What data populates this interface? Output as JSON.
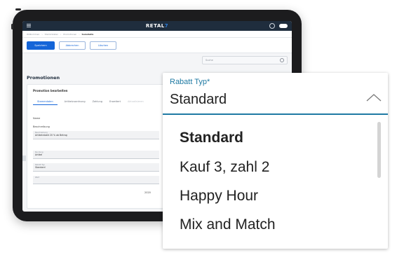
{
  "app": {
    "logo": "RETAL",
    "logo_suffix": "7"
  },
  "breadcrumb": [
    "Willkommen",
    "Stammdaten",
    "Promotionen",
    "Samstatis"
  ],
  "toolbar": {
    "save_label": "Speichern",
    "cancel_label": "Abbrechen",
    "delete_label": "Löschen",
    "search_placeholder": "Suche"
  },
  "page": {
    "title": "Promotionen",
    "actions": [
      "Importieren",
      "Download",
      "Aktualisieren"
    ]
  },
  "card": {
    "title": "Promotion bearbeiten",
    "tabs": [
      "Stammdaten",
      "Artikelzuordnung",
      "Zahlung",
      "Erweitert",
      "Aktualisieren"
    ],
    "name_label": "Name",
    "description_label": "Beschreibung",
    "description_small": "Beschreibung",
    "description_value": "Artikelrabatt 20 % ab Betrag",
    "field1_small": "Rundung",
    "field1_value": "Artikel",
    "field2_small": "Rabatt Typ",
    "field2_value": "Standard",
    "field3_small": "Wert",
    "field3_number": "2020"
  },
  "dropdown": {
    "label": "Rabatt Typ*",
    "value": "Standard",
    "options": [
      "Standard",
      "Kauf 3, zahl 2",
      "Happy Hour",
      "Mix and Match"
    ],
    "selected_index": 0
  },
  "colors": {
    "accent": "#1f7aa3",
    "primary_button": "#1565d8",
    "header_bg": "#1f2d3d"
  }
}
